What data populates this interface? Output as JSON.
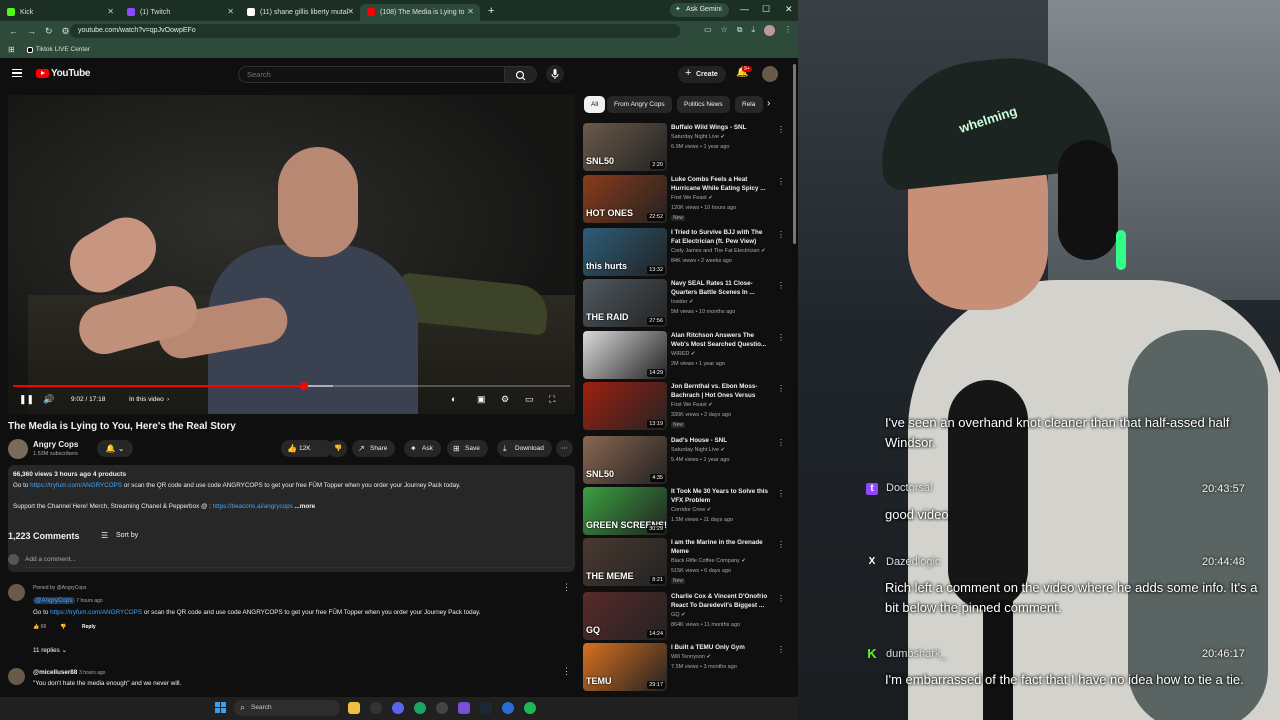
{
  "browser": {
    "tabs": [
      {
        "label": "Kick",
        "favicon_color": "#53fc18"
      },
      {
        "label": "(1) Twitch",
        "favicon_color": "#9146ff"
      },
      {
        "label": "(11) shane gillis liberty mutal -",
        "favicon_color": "#ffffff"
      },
      {
        "label": "(108) The Media is Lying to",
        "favicon_color": "#ff0000"
      }
    ],
    "gemini_label": "Ask Gemini",
    "url": "youtube.com/watch?v=qpJvOowpEFo",
    "bookmark": "Tiktok LIVE Center"
  },
  "youtube": {
    "logo": "YouTube",
    "search_placeholder": "Search",
    "create_label": "Create",
    "notif_badge": "9+",
    "player": {
      "time": "9:02 / 17:18",
      "in_this_video": "In this video",
      "progress": 0.522,
      "buffered": 0.575
    },
    "video_title": "The Media is Lying to You, Here's the Real Story",
    "channel": {
      "name": "Angry Cops",
      "subs": "1.53M subscribers"
    },
    "actions": {
      "likes": "12K",
      "share": "Share",
      "ask": "Ask",
      "save": "Save",
      "download": "Download"
    },
    "description": {
      "meta": "66,360 views  3 hours ago  4 products",
      "line1_pre": "Go to ",
      "line1_link": "https://tryfum.com/ANGRYCOPS",
      "line1_post": " or scan the QR code and use code ANGRYCOPS to get your free FŪM Topper when you order your Journey Pack today.",
      "line2_pre": "Support the Channel Here! Merch, Streaming Chanel & Pepperbox @ : ",
      "line2_link": "https://beacons.ai/angrycops",
      "more": "...more"
    },
    "comments": {
      "count": "1,223 Comments",
      "sort": "Sort by",
      "add_placeholder": "Add a comment...",
      "pinned": {
        "pinned_by": "Pinned by @AngryCops",
        "author": "@AngryCops",
        "time": "7 hours ago",
        "text_pre": "Go to ",
        "text_link": "https://tryfum.com/ANGRYCOPS",
        "text_post": " or scan the QR code and use code ANGRYCOPS to get your free FŪM Topper when you order your Journey Pack today.",
        "likes": "68",
        "reply": "Reply",
        "replies": "11 replies"
      },
      "second": {
        "author": "@micelluser88",
        "time": "3 hours ago",
        "text": "\"You don't hate the media enough\" and we never will."
      }
    },
    "chips": [
      "All",
      "From Angry Cops",
      "Politics News",
      "Rela"
    ],
    "recommendations": [
      {
        "title": "Buffalo Wild Wings - SNL",
        "channel": "Saturday Night Live",
        "meta": "6.9M views • 1 year ago",
        "duration": "2:20",
        "new": "",
        "color": "#6b5a4a",
        "overlay": "SNL50"
      },
      {
        "title": "Luke Combs Feels a Heat Hurricane While Eating Spicy ...",
        "channel": "First We Feast",
        "meta": "120K views • 10 hours ago",
        "duration": "22:52",
        "new": "New",
        "color": "#8a3b1a",
        "overlay": "HOT ONES"
      },
      {
        "title": "I Tried to Survive BJJ with The Fat Electrician (ft. Pew View)",
        "channel": "Cody James and The Fat Electrician",
        "meta": "84K views • 2 weeks ago",
        "duration": "13:32",
        "new": "",
        "color": "#2d5d7a",
        "overlay": "this hurts"
      },
      {
        "title": "Navy SEAL Rates 11 Close-Quarters Battle Scenes In ...",
        "channel": "Insider",
        "meta": "5M views • 10 months ago",
        "duration": "27:56",
        "new": "",
        "color": "#4f5a60",
        "overlay": "THE RAID"
      },
      {
        "title": "Alan Ritchson Answers The Web's Most Searched Questio...",
        "channel": "WIRED",
        "meta": "2M views • 1 year ago",
        "duration": "14:29",
        "new": "",
        "color": "#dadada",
        "overlay": ""
      },
      {
        "title": "Jon Bernthal vs. Ebon Moss-Bachrach | Hot Ones Versus",
        "channel": "First We Feast",
        "meta": "330K views • 2 days ago",
        "duration": "13:19",
        "new": "New",
        "color": "#a02010",
        "overlay": ""
      },
      {
        "title": "Dad's House - SNL",
        "channel": "Saturday Night Live",
        "meta": "5.4M views • 1 year ago",
        "duration": "4:35",
        "new": "",
        "color": "#8a6650",
        "overlay": "SNL50"
      },
      {
        "title": "It Took Me 30 Years to Solve this VFX Problem",
        "channel": "Corridor Crew",
        "meta": "1.5M views • 11 days ago",
        "duration": "30:29",
        "new": "",
        "color": "#3aa040",
        "overlay": "GREEN SCREENS!"
      },
      {
        "title": "I am the Marine in the Grenade Meme",
        "channel": "Black Rifle Coffee Company",
        "meta": "515K views • 6 days ago",
        "duration": "8:21",
        "new": "New",
        "color": "#4a3a30",
        "overlay": "THE MEME"
      },
      {
        "title": "Charlie Cox & Vincent D'Onofrio React To Daredevil's Biggest ...",
        "channel": "GQ",
        "meta": "864K views • 11 months ago",
        "duration": "14:24",
        "new": "",
        "color": "#5a2a2a",
        "overlay": "GQ"
      },
      {
        "title": "I Built a TEMU Only Gym",
        "channel": "Will Tennyson",
        "meta": "7.5M views • 3 months ago",
        "duration": "29:17",
        "new": "",
        "color": "#d87020",
        "overlay": "TEMU"
      }
    ]
  },
  "taskbar": {
    "search": "Search"
  },
  "stream_overlay": {
    "cap_text": "whelming",
    "messages": [
      {
        "platform": "",
        "user": "",
        "time": "",
        "text": "I've seen an overhand knot cleaner than that half-assed half Windsor."
      },
      {
        "platform": "twitch",
        "user": "Doctorsal",
        "time": "20:43:57",
        "text": "good video"
      },
      {
        "platform": "x",
        "user": "Dazedlogic",
        "time": "20:44:48",
        "text": "Rich left a comment on the video where he adds some info. It's a bit below the pinned comment."
      },
      {
        "platform": "kick",
        "user": "dumbshark_",
        "time": "20:46:17",
        "text": "I'm embarrassed of the fact that I have no idea how to tie a tie."
      }
    ]
  }
}
